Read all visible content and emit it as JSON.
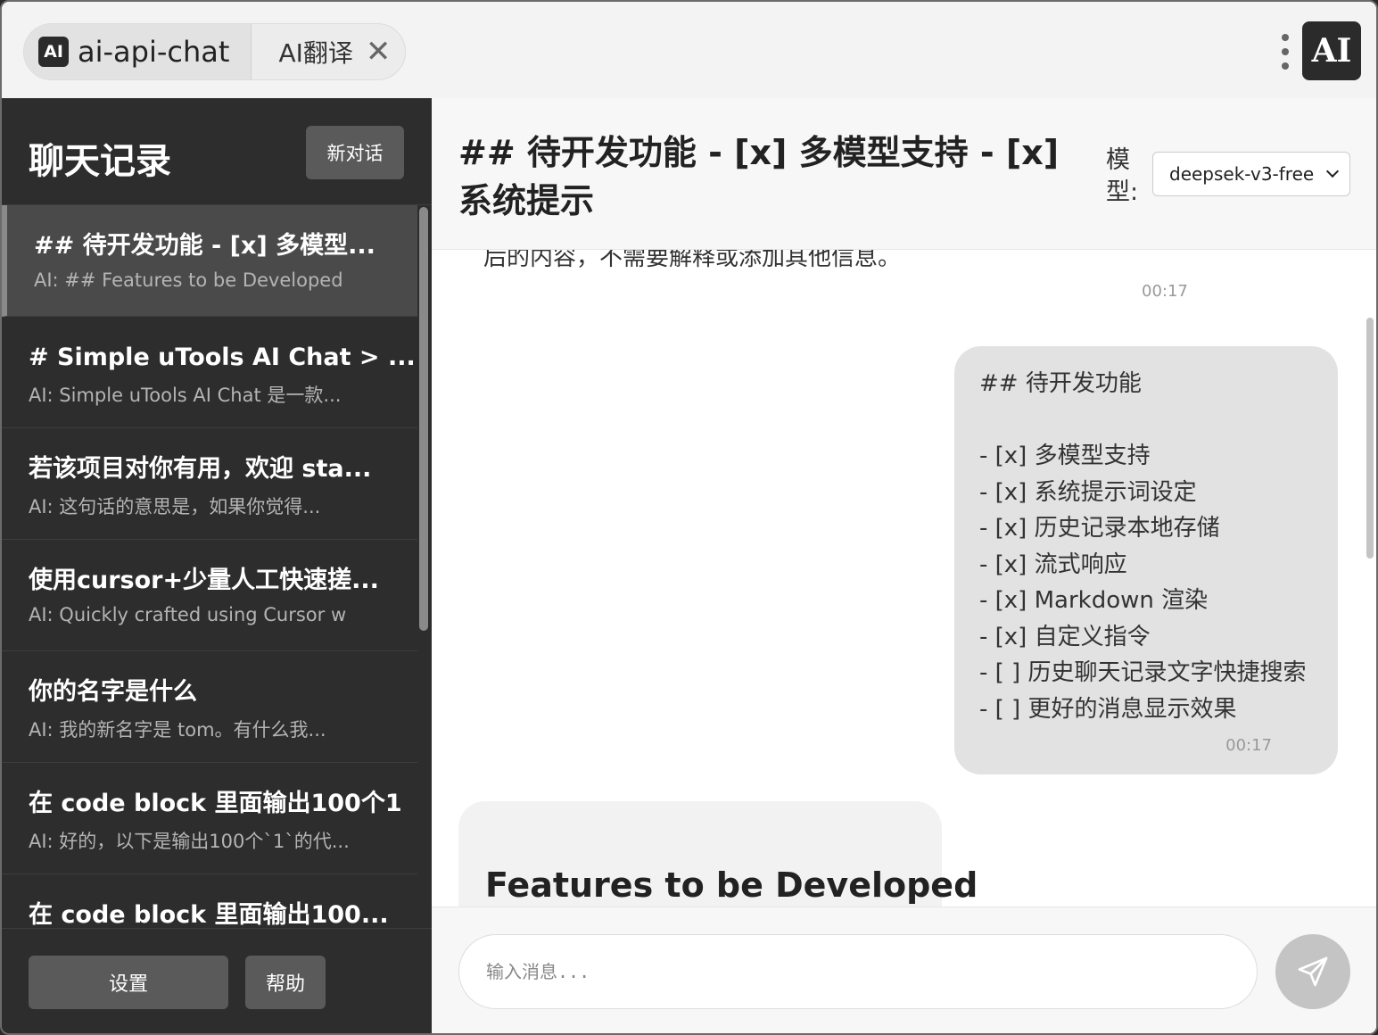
{
  "window": {
    "tabs": [
      {
        "label": "ai-api-chat",
        "icon": "AI",
        "active": true
      },
      {
        "label": "AI翻译",
        "active": false
      }
    ],
    "logo_text": "AI"
  },
  "sidebar": {
    "title": "聊天记录",
    "new_chat_label": "新对话",
    "items": [
      {
        "title": "## 待开发功能 - [x] 多模型...",
        "preview": "AI: ## Features to be Developed"
      },
      {
        "title": "# Simple uTools AI Chat > ...",
        "preview": "AI: Simple uTools AI Chat 是一款..."
      },
      {
        "title": "若该项目对你有用，欢迎 sta...",
        "preview": "AI: 这句话的意思是，如果你觉得..."
      },
      {
        "title": "使用cursor+少量人工快速搓...",
        "preview": "AI: Quickly crafted using Cursor w"
      },
      {
        "title": "你的名字是什么",
        "preview": "AI: 我的新名字是 tom。有什么我..."
      },
      {
        "title": "在 code block 里面输出100个1",
        "preview": "AI: 好的，以下是输出100个`1`的代..."
      },
      {
        "title": "在 code block 里面输出100...",
        "preview": ""
      }
    ],
    "settings_label": "设置",
    "help_label": "帮助"
  },
  "main": {
    "title": "## 待开发功能 - [x] 多模型支持 - [x] 系统提示",
    "model_label": "模型:",
    "model_value": "deepsek-v3-free",
    "messages": {
      "cut_text": "后的内容，不需要解释或添加其他信息。",
      "time_1": "00:17",
      "user_text": "## 待开发功能\n\n- [x] 多模型支持\n- [x] 系统提示词设定\n- [x] 历史记录本地存储\n- [x] 流式响应\n- [x] Markdown 渲染\n- [x] 自定义指令\n- [ ] 历史聊天记录文字快捷搜索\n- [ ] 更好的消息显示效果",
      "time_2": "00:17",
      "ai_heading": "Features to be Developed"
    },
    "input_placeholder": "输入消息..."
  }
}
